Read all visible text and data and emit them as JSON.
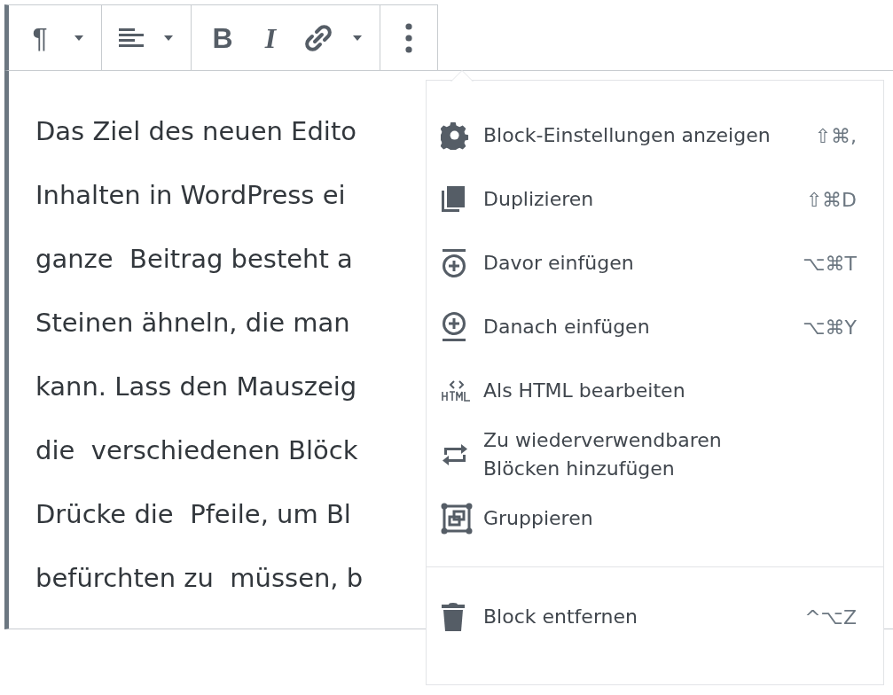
{
  "toolbar": {
    "groups": [
      {
        "buttons": [
          {
            "kind": "pilcrow",
            "label": "¶"
          },
          {
            "kind": "caret"
          }
        ]
      },
      {
        "buttons": [
          {
            "kind": "align"
          },
          {
            "kind": "caret"
          }
        ]
      },
      {
        "buttons": [
          {
            "kind": "bold",
            "label": "B"
          },
          {
            "kind": "italic",
            "label": "I"
          },
          {
            "kind": "link"
          },
          {
            "kind": "caret"
          }
        ]
      },
      {
        "buttons": [
          {
            "kind": "more"
          }
        ]
      }
    ]
  },
  "paragraph": {
    "lines": [
      "Das Ziel des neuen Edito",
      "Inhalten in WordPress ei",
      "ganze  Beitrag besteht a",
      "Steinen ähneln, die man",
      "kann. Lass den Mauszeig",
      "die  verschiedenen Blöck",
      "Drücke die  Pfeile, um Bl",
      "befürchten zu  müssen, b"
    ]
  },
  "menu": {
    "groups": [
      [
        {
          "label": "Block-Einstellungen anzeigen",
          "shortcut": "⇧⌘,"
        },
        {
          "label": "Duplizieren",
          "shortcut": "⇧⌘D"
        },
        {
          "label": "Davor einfügen",
          "shortcut": "⌥⌘T"
        },
        {
          "label": "Danach einfügen",
          "shortcut": "⌥⌘Y"
        },
        {
          "label": "Als HTML bearbeiten"
        },
        {
          "label": "Zu wiederverwendbaren Blöcken hinzufügen"
        },
        {
          "label": "Gruppieren"
        }
      ],
      [
        {
          "label": "Block entfernen",
          "shortcut": "^⌥Z"
        }
      ]
    ]
  }
}
